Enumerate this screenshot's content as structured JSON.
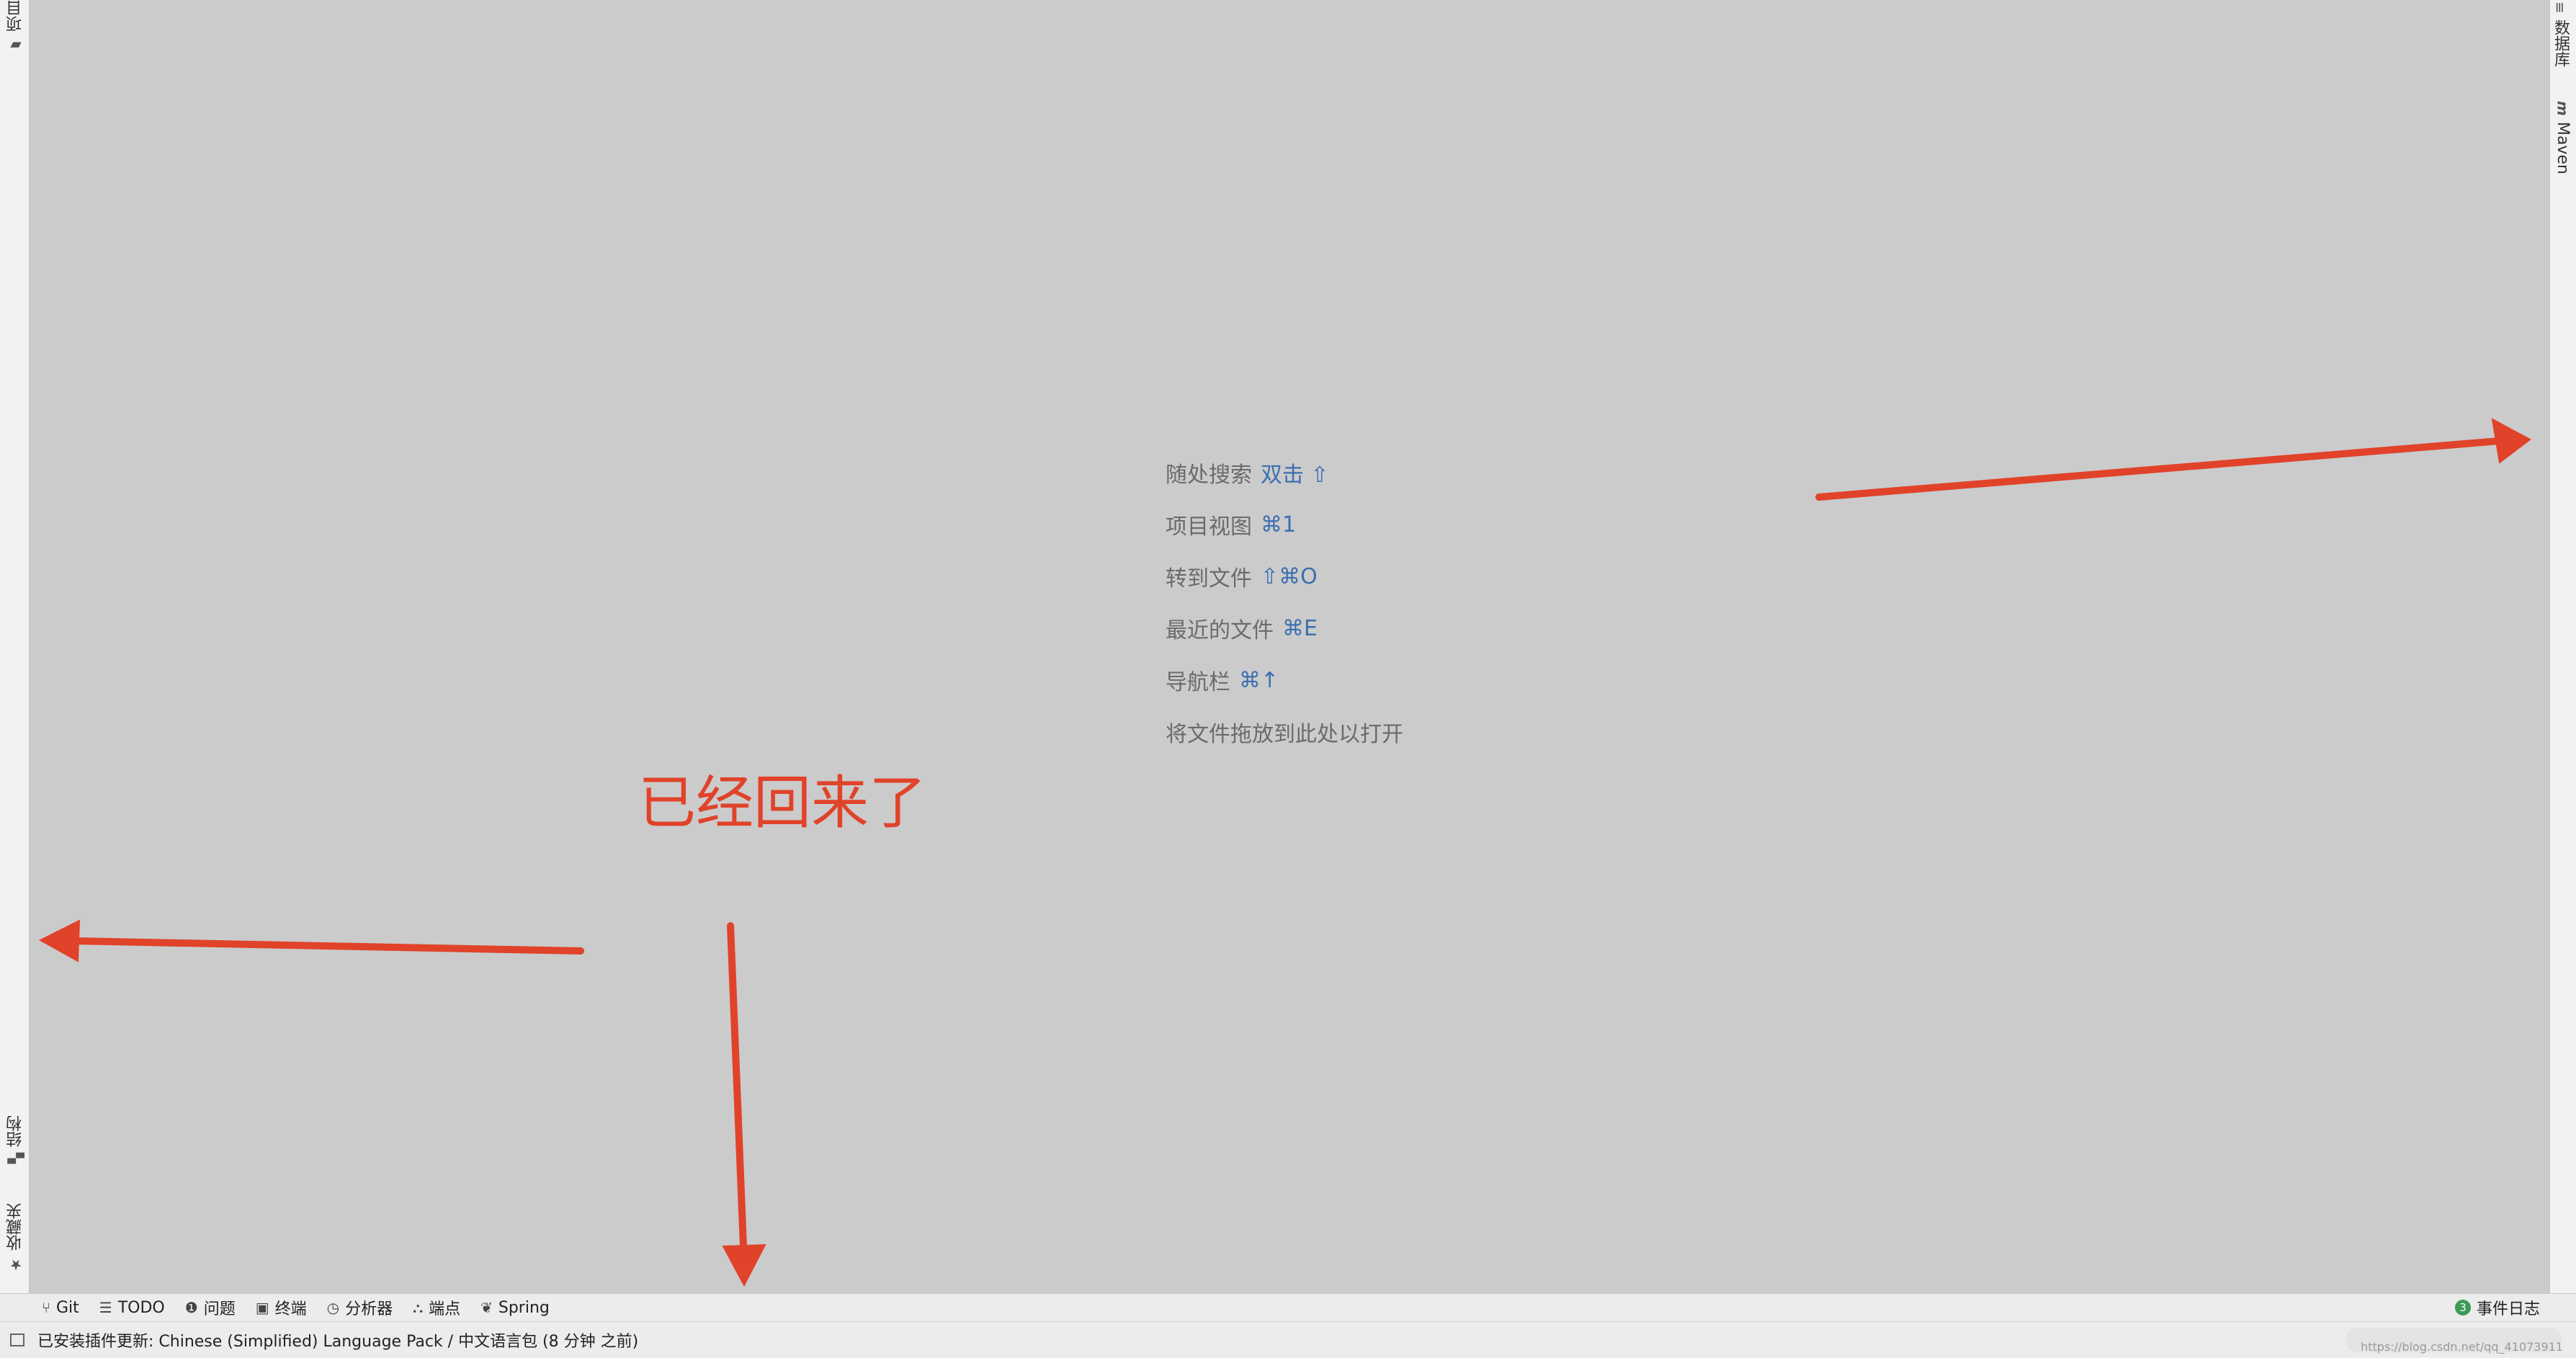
{
  "left_sidebar": {
    "project_tab": "项目",
    "structure_tab": "结构",
    "favorites_tab": "收藏夹"
  },
  "right_sidebar": {
    "database_tab": "数据库",
    "maven_tab": "Maven"
  },
  "editor_hints": [
    {
      "label": "随处搜索",
      "shortcut": "双击 ⇧"
    },
    {
      "label": "项目视图",
      "shortcut": "⌘1"
    },
    {
      "label": "转到文件",
      "shortcut": "⇧⌘O"
    },
    {
      "label": "最近的文件",
      "shortcut": "⌘E"
    },
    {
      "label": "导航栏",
      "shortcut": "⌘↑"
    },
    {
      "label": "将文件拖放到此处以打开",
      "shortcut": ""
    }
  ],
  "annotation": {
    "text": "已经回来了",
    "color": "#e0432a"
  },
  "tool_windows": {
    "git": "Git",
    "todo": "TODO",
    "problems": "问题",
    "terminal": "终端",
    "profiler": "分析器",
    "endpoints": "端点",
    "spring": "Spring",
    "event_log": "事件日志",
    "event_count": "3"
  },
  "status_bar": {
    "message": "已安装插件更新: Chinese (Simplified) Language Pack / 中文语言包 (8 分钟 之前)",
    "watermark": "https://blog.csdn.net/qq_41073911"
  },
  "colors": {
    "background": "#cbcbcb",
    "shortcut": "#3c6fb0",
    "annotation": "#e0432a"
  }
}
